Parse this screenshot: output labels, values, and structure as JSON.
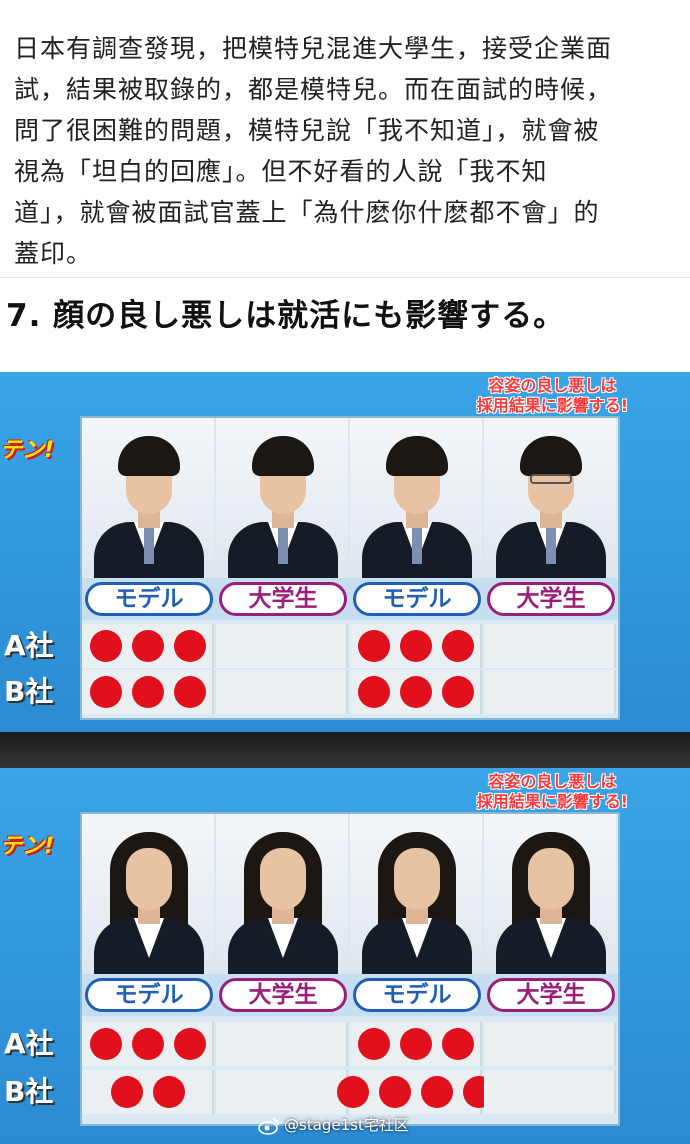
{
  "post": {
    "lines": [
      "日本有調查發現，把模特兒混進大學生，接受企業面",
      "試，結果被取錄的，都是模特兒。而在面試的時候，",
      "問了很困難的問題，模特兒說「我不知道」，就會被",
      "視為「坦白的回應」。但不好看的人說「我不知",
      "道」，就會被面試官蓋上「為什麽你什麽都不會」的",
      "蓋印。"
    ]
  },
  "heading": "7. 顔の良し悪しは就活にも影響する。",
  "panels": [
    {
      "show_logo": "テン!",
      "caption_line1": "容姿の良し悪しは",
      "caption_line2": "採用結果に影響する!",
      "labels": [
        "モデル",
        "大学生",
        "モデル",
        "大学生"
      ],
      "companies": [
        {
          "name": "A社",
          "marks": [
            3,
            0,
            3,
            0
          ]
        },
        {
          "name": "B社",
          "marks": [
            3,
            0,
            3,
            0
          ]
        }
      ]
    },
    {
      "show_logo": "テン!",
      "caption_line1": "容姿の良し悪しは",
      "caption_line2": "採用結果に影響する!",
      "labels": [
        "モデル",
        "大学生",
        "モデル",
        "大学生"
      ],
      "companies": [
        {
          "name": "A社",
          "marks": [
            3,
            0,
            3,
            0
          ]
        },
        {
          "name": "B社",
          "marks": [
            2,
            0,
            4,
            0
          ]
        }
      ]
    }
  ],
  "watermark": "@stage1st宅社区",
  "colors": {
    "dot": "#e0101c",
    "panel_bg": "#2f96dc",
    "model_label": "#1f5fb6",
    "student_label": "#9b1f7a"
  },
  "icons": {
    "watermark": "weibo-icon"
  }
}
